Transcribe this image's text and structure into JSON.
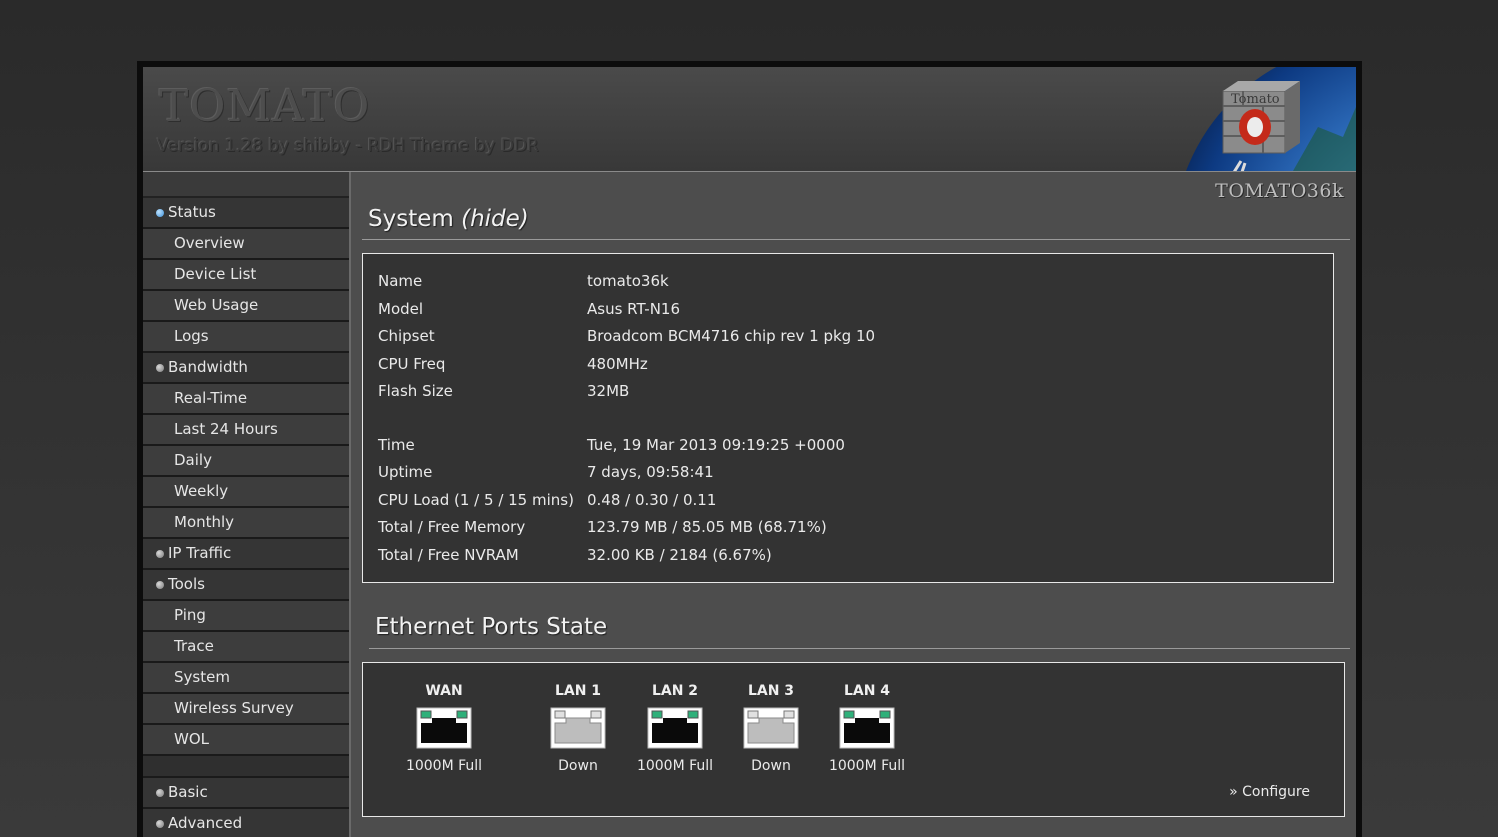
{
  "header": {
    "logo_title": "TOMATO",
    "logo_subtitle": "Version 1.28 by shibby - RDH Theme by DDR",
    "model_tag": "TOMATO36k"
  },
  "sidebar": {
    "items": [
      {
        "label": "Status",
        "type": "section",
        "active": true
      },
      {
        "label": "Overview",
        "type": "sub"
      },
      {
        "label": "Device List",
        "type": "sub"
      },
      {
        "label": "Web Usage",
        "type": "sub"
      },
      {
        "label": "Logs",
        "type": "sub"
      },
      {
        "label": "Bandwidth",
        "type": "section"
      },
      {
        "label": "Real-Time",
        "type": "sub"
      },
      {
        "label": "Last 24 Hours",
        "type": "sub"
      },
      {
        "label": "Daily",
        "type": "sub"
      },
      {
        "label": "Weekly",
        "type": "sub"
      },
      {
        "label": "Monthly",
        "type": "sub"
      },
      {
        "label": "IP Traffic",
        "type": "section"
      },
      {
        "label": "Tools",
        "type": "section"
      },
      {
        "label": "Ping",
        "type": "sub"
      },
      {
        "label": "Trace",
        "type": "sub"
      },
      {
        "label": "System",
        "type": "sub"
      },
      {
        "label": "Wireless Survey",
        "type": "sub"
      },
      {
        "label": "WOL",
        "type": "sub"
      },
      {
        "label": "Basic",
        "type": "section"
      },
      {
        "label": "Advanced",
        "type": "section"
      }
    ]
  },
  "system": {
    "title": "System",
    "hide_link": "(hide)",
    "rows_a": [
      {
        "label": "Name",
        "value": "tomato36k"
      },
      {
        "label": "Model",
        "value": "Asus RT-N16"
      },
      {
        "label": "Chipset",
        "value": "Broadcom BCM4716 chip rev 1 pkg 10"
      },
      {
        "label": "CPU Freq",
        "value": "480MHz"
      },
      {
        "label": "Flash Size",
        "value": "32MB"
      }
    ],
    "rows_b": [
      {
        "label": "Time",
        "value": "Tue, 19 Mar 2013 09:19:25 +0000"
      },
      {
        "label": "Uptime",
        "value": "7 days, 09:58:41"
      },
      {
        "label": "CPU Load (1 / 5 / 15 mins)",
        "value": "0.48 / 0.30 / 0.11"
      },
      {
        "label": "Total / Free Memory",
        "value": "123.79 MB / 85.05 MB (68.71%)"
      },
      {
        "label": "Total / Free NVRAM",
        "value": "32.00 KB / 2184 (6.67%)"
      }
    ]
  },
  "ethernet": {
    "title": "Ethernet Ports State",
    "ports": [
      {
        "name": "WAN",
        "state": "1000M Full",
        "connected": true
      },
      {
        "name": "LAN 1",
        "state": "Down",
        "connected": false
      },
      {
        "name": "LAN 2",
        "state": "1000M Full",
        "connected": true
      },
      {
        "name": "LAN 3",
        "state": "Down",
        "connected": false
      },
      {
        "name": "LAN 4",
        "state": "1000M Full",
        "connected": true
      }
    ],
    "configure_label": "» Configure"
  },
  "colors": {
    "active_bullet": "#3a8fd8",
    "port_led": "#2fb07a"
  }
}
